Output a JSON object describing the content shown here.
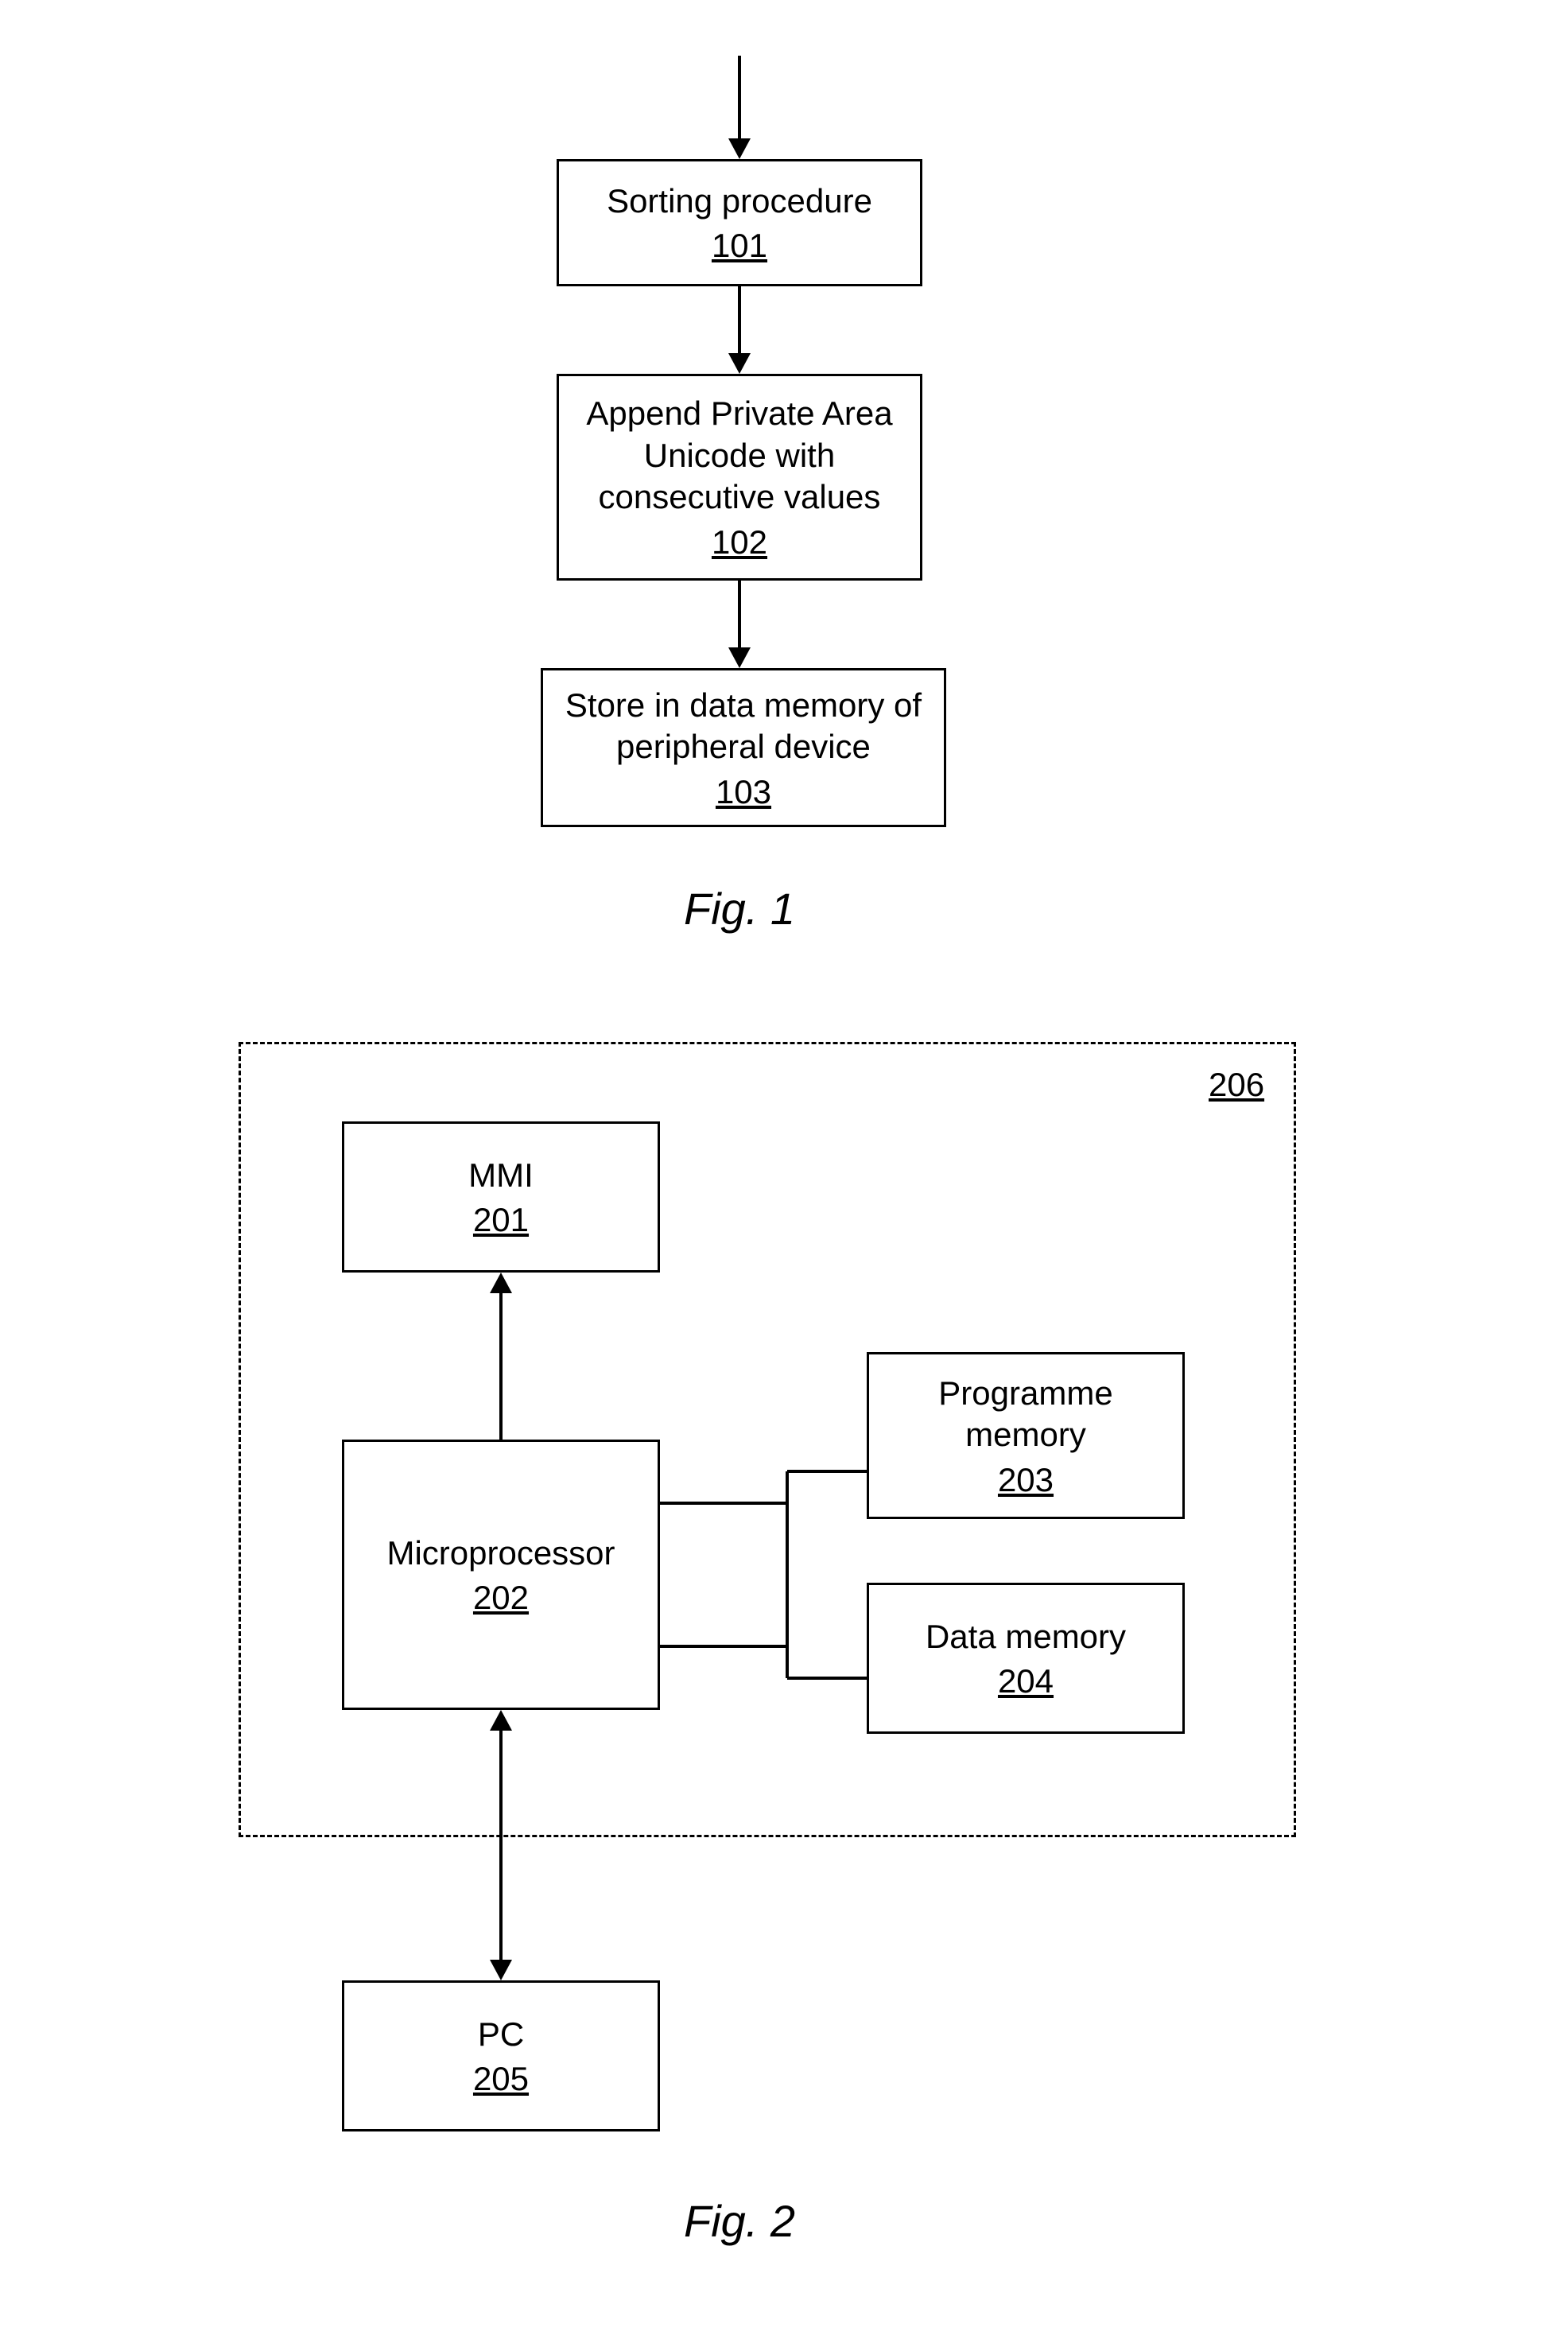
{
  "fig1": {
    "caption": "Fig. 1",
    "box101": {
      "label": "Sorting procedure",
      "ref": "101"
    },
    "box102": {
      "label": "Append Private Area\nUnicode with\nconsecutive values",
      "ref": "102"
    },
    "box103": {
      "label": "Store in data memory of\nperipheral device",
      "ref": "103"
    }
  },
  "fig2": {
    "caption": "Fig. 2",
    "frame_ref": "206",
    "mmi": {
      "label": "MMI",
      "ref": "201"
    },
    "micro": {
      "label": "Microprocessor",
      "ref": "202"
    },
    "prog": {
      "label": "Programme\nmemory",
      "ref": "203"
    },
    "data": {
      "label": "Data memory",
      "ref": "204"
    },
    "pc": {
      "label": "PC",
      "ref": "205"
    }
  }
}
